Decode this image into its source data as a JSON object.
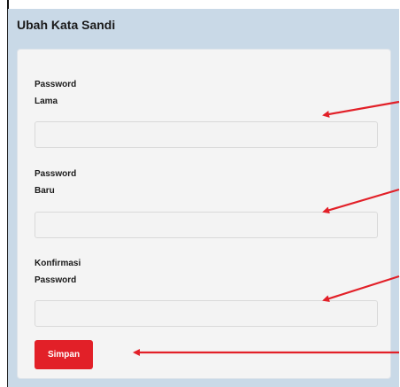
{
  "form": {
    "title": "Ubah Kata Sandi",
    "old_password_label_line1": "Password",
    "old_password_label_line2": "Lama",
    "old_password_value": "",
    "new_password_label_line1": "Password",
    "new_password_label_line2": "Baru",
    "new_password_value": "",
    "confirm_password_label_line1": "Konfirmasi",
    "confirm_password_label_line2": "Password",
    "confirm_password_value": "",
    "submit_label": "Simpan"
  },
  "colors": {
    "panel_background": "#c9d9e7",
    "card_background": "#f4f4f4",
    "button_background": "#e22028",
    "annotation_arrow": "#e22028"
  },
  "annotations": {
    "arrow_count": 4
  }
}
